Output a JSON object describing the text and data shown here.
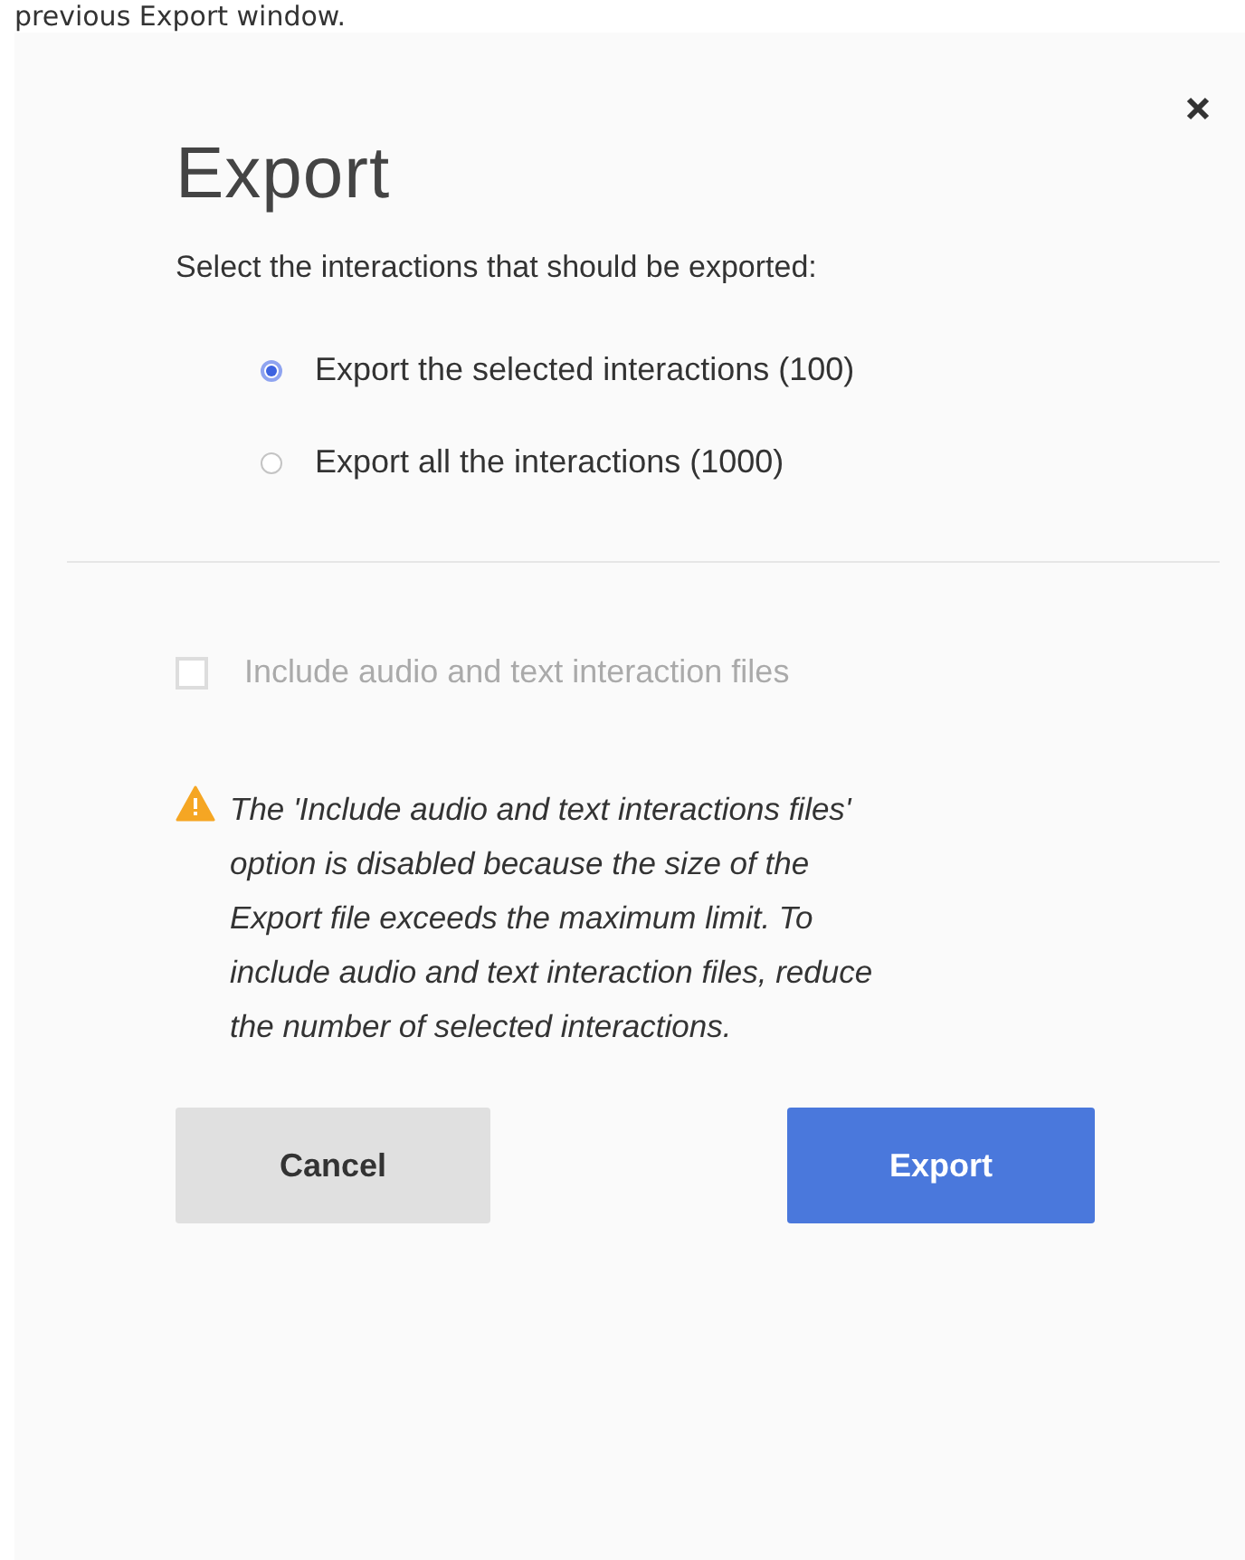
{
  "caption": "previous Export window.",
  "dialog": {
    "title": "Export",
    "prompt": "Select the interactions that should be exported:",
    "options": [
      {
        "label": "Export the selected interactions (100)",
        "selected": true
      },
      {
        "label": "Export all the interactions (1000)",
        "selected": false
      }
    ],
    "include_files": {
      "label": "Include audio and text interaction files",
      "checked": false,
      "disabled": true
    },
    "warning": "The 'Include audio and text interactions files' option is disabled because the size of the Export file exceeds the maximum limit. To include audio and text interaction files, reduce the number of selected interactions.",
    "buttons": [
      {
        "label": "Cancel",
        "kind": "secondary"
      },
      {
        "label": "Export",
        "kind": "primary"
      }
    ]
  }
}
